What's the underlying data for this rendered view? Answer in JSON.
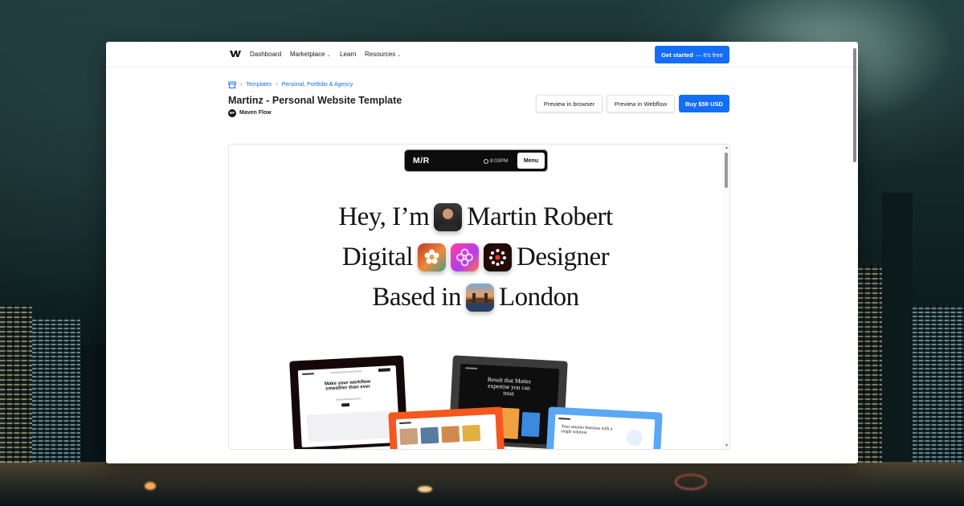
{
  "nav": {
    "items": [
      {
        "label": "Dashboard",
        "has_caret": false
      },
      {
        "label": "Marketplace",
        "has_caret": true
      },
      {
        "label": "Learn",
        "has_caret": false
      },
      {
        "label": "Resources",
        "has_caret": true
      }
    ],
    "caret_glyph": "⌄",
    "cta_bold": "Get started",
    "cta_rest": "— It's free"
  },
  "breadcrumb": {
    "items": [
      "Templates",
      "Personal, Portfolio & Agency"
    ],
    "separator": "›"
  },
  "template": {
    "title": "Martinz - Personal Website Template",
    "author": "Maven Flow",
    "author_badge": "MF"
  },
  "actions": {
    "preview_browser": "Preview in browser",
    "preview_webflow": "Preview in Webflow",
    "buy": "Buy  $59 USD"
  },
  "preview": {
    "site_logo": "M/R",
    "time": "8:03PM",
    "menu": "Menu",
    "hero": {
      "line1_a": "Hey, I’m",
      "line1_b": "Martin Robert",
      "line2_a": "Digital",
      "line2_b": "Designer",
      "line3_a": "Based in",
      "line3_b": "London"
    },
    "mockups": {
      "m1_headline": "Make your workflow smoother than ever",
      "m2_headline": "Result that Matter expertise you can trust",
      "m4_headline": "Your smarter business with a single solution"
    }
  },
  "colors": {
    "accent": "#146ef5",
    "orange": "#f4581f",
    "sky": "#5aa7f5",
    "dark_mock": "#3a3a3a"
  },
  "icons": [
    "webflow-logo-icon",
    "store-icon",
    "clock-icon",
    "avatar-icon",
    "flower-icon",
    "pink-flower-icon",
    "ring-icon",
    "london-photo-icon"
  ]
}
